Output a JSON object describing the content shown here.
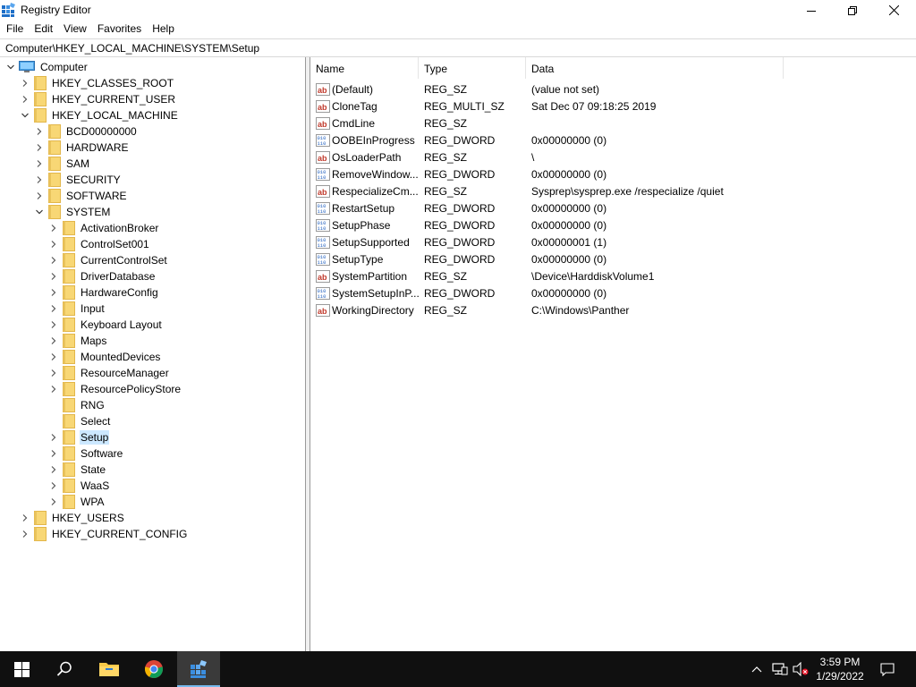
{
  "window": {
    "title": "Registry Editor",
    "icon": "registry-editor-icon"
  },
  "menu": [
    "File",
    "Edit",
    "View",
    "Favorites",
    "Help"
  ],
  "address": "Computer\\HKEY_LOCAL_MACHINE\\SYSTEM\\Setup",
  "tree": {
    "root": "Computer",
    "hives": [
      "HKEY_CLASSES_ROOT",
      "HKEY_CURRENT_USER",
      "HKEY_LOCAL_MACHINE"
    ],
    "hklm_children": [
      "BCD00000000",
      "HARDWARE",
      "SAM",
      "SECURITY",
      "SOFTWARE",
      "SYSTEM"
    ],
    "system_children": [
      "ActivationBroker",
      "ControlSet001",
      "CurrentControlSet",
      "DriverDatabase",
      "HardwareConfig",
      "Input",
      "Keyboard Layout",
      "Maps",
      "MountedDevices",
      "ResourceManager",
      "ResourcePolicyStore",
      "RNG",
      "Select",
      "Setup",
      "Software",
      "State",
      "WaaS",
      "WPA"
    ],
    "trailing_hives": [
      "HKEY_USERS",
      "HKEY_CURRENT_CONFIG"
    ],
    "selected": "Setup"
  },
  "list": {
    "headers": {
      "name": "Name",
      "type": "Type",
      "data": "Data"
    },
    "rows": [
      {
        "name": "(Default)",
        "type": "REG_SZ",
        "data": "(value not set)",
        "icon": "string"
      },
      {
        "name": "CloneTag",
        "type": "REG_MULTI_SZ",
        "data": "Sat Dec 07 09:18:25 2019",
        "icon": "string"
      },
      {
        "name": "CmdLine",
        "type": "REG_SZ",
        "data": "",
        "icon": "string"
      },
      {
        "name": "OOBEInProgress",
        "type": "REG_DWORD",
        "data": "0x00000000 (0)",
        "icon": "binary"
      },
      {
        "name": "OsLoaderPath",
        "type": "REG_SZ",
        "data": "\\",
        "icon": "string"
      },
      {
        "name": "RemoveWindow...",
        "type": "REG_DWORD",
        "data": "0x00000000 (0)",
        "icon": "binary"
      },
      {
        "name": "RespecializeCm...",
        "type": "REG_SZ",
        "data": "Sysprep\\sysprep.exe /respecialize /quiet",
        "icon": "string"
      },
      {
        "name": "RestartSetup",
        "type": "REG_DWORD",
        "data": "0x00000000 (0)",
        "icon": "binary"
      },
      {
        "name": "SetupPhase",
        "type": "REG_DWORD",
        "data": "0x00000000 (0)",
        "icon": "binary"
      },
      {
        "name": "SetupSupported",
        "type": "REG_DWORD",
        "data": "0x00000001 (1)",
        "icon": "binary"
      },
      {
        "name": "SetupType",
        "type": "REG_DWORD",
        "data": "0x00000000 (0)",
        "icon": "binary"
      },
      {
        "name": "SystemPartition",
        "type": "REG_SZ",
        "data": "\\Device\\HarddiskVolume1",
        "icon": "string"
      },
      {
        "name": "SystemSetupInP...",
        "type": "REG_DWORD",
        "data": "0x00000000 (0)",
        "icon": "binary"
      },
      {
        "name": "WorkingDirectory",
        "type": "REG_SZ",
        "data": "C:\\Windows\\Panther",
        "icon": "string"
      }
    ]
  },
  "taskbar": {
    "time": "3:59 PM",
    "date": "1/29/2022"
  },
  "colors": {
    "folder": "#f8d775",
    "selection": "#cce8ff",
    "taskbar": "#101010",
    "accent": "#76b9ed"
  }
}
